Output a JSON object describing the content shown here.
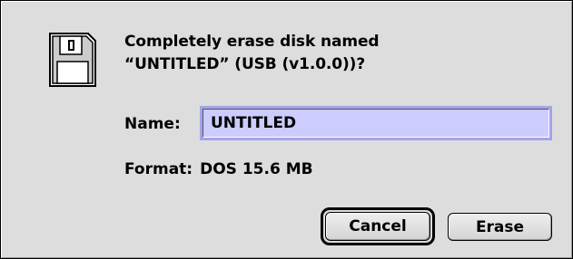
{
  "dialog": {
    "icon": "floppy-disk-icon",
    "message_line1": "Completely erase disk named",
    "message_line2": "“UNTITLED” (USB (v1.0.0))?",
    "name_label": "Name:",
    "name_value": "UNTITLED",
    "format_label": "Format:",
    "format_value": "DOS 15.6 MB",
    "cancel_label": "Cancel",
    "erase_label": "Erase",
    "default_button": "cancel"
  },
  "colors": {
    "background": "#dddddd",
    "field_highlight": "#ccccff",
    "focus_ring": "#a3a3ea"
  }
}
